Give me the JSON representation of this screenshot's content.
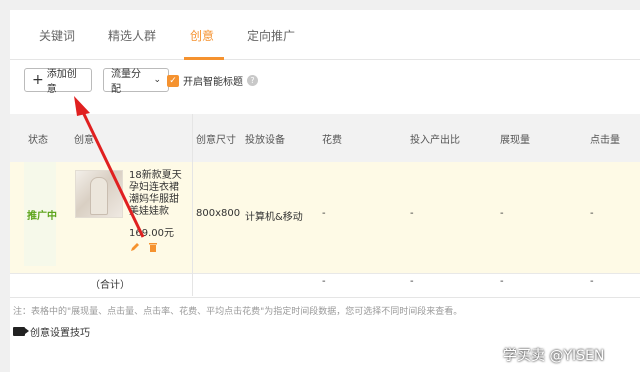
{
  "tabs": [
    "关键词",
    "精选人群",
    "创意",
    "定向推广"
  ],
  "active_tab_index": 2,
  "toolbar": {
    "add_creative_label": "添加创意",
    "traffic_label": "流量分配",
    "smart_title_label": "开启智能标题",
    "smart_title_checked": true
  },
  "table": {
    "headers": [
      "状态",
      "创意",
      "创意尺寸",
      "投放设备",
      "花费",
      "投入产出比",
      "展现量",
      "点击量"
    ],
    "row": {
      "status": "推广中",
      "title": "18新款夏天孕妇连衣裙潮妈华服甜美娃娃款",
      "price": "169.00元",
      "size": "800x800",
      "device": "计算机&移动",
      "cost": "-",
      "roi": "-",
      "impressions": "-",
      "clicks": "-"
    },
    "summary": {
      "label": "（合计）",
      "cost": "-",
      "roi": "-",
      "impressions": "-",
      "clicks": "-"
    }
  },
  "note": "注：表格中的\"展现量、点击量、点击率、花费、平均点击花费\"为指定时间段数据，您可选择不同时间段来查看。",
  "tips_label": "创意设置技巧",
  "watermark": "学买卖 @YISEN",
  "colors": {
    "accent": "#f5922f",
    "status_green": "#5da41b",
    "arrow_red": "#e02020"
  }
}
